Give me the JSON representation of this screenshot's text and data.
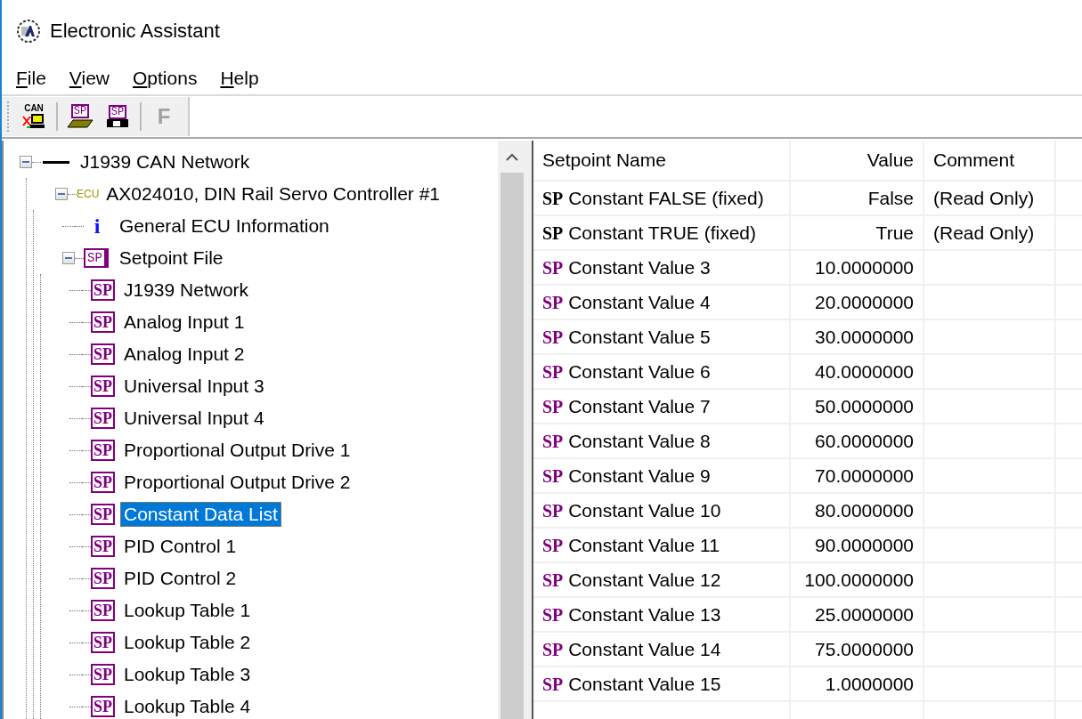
{
  "window": {
    "title": "Electronic Assistant"
  },
  "menu": [
    "File",
    "View",
    "Options",
    "Help"
  ],
  "toolbar": [
    {
      "kind": "can",
      "label": "CAN",
      "disabled": false
    },
    {
      "kind": "open",
      "label": "SP",
      "disabled": false
    },
    {
      "kind": "save",
      "label": "SP",
      "disabled": false
    },
    {
      "kind": "text",
      "label": "F",
      "disabled": true
    }
  ],
  "tree": [
    {
      "kind": "network",
      "label": "J1939 CAN Network",
      "selected": false,
      "expanded": true,
      "children": [
        {
          "kind": "ecu",
          "icon": "ECU",
          "label": "AX024010, DIN Rail Servo Controller #1",
          "selected": false,
          "expanded": true,
          "children": [
            {
              "kind": "info",
              "icon": "i",
              "label": "General ECU Information",
              "selected": false
            },
            {
              "kind": "file",
              "icon": "SP",
              "label": "Setpoint File",
              "selected": false,
              "expanded": true,
              "children": [
                {
                  "kind": "setpoint",
                  "icon": "SP",
                  "label": "J1939 Network",
                  "selected": false
                },
                {
                  "kind": "setpoint",
                  "icon": "SP",
                  "label": "Analog Input 1",
                  "selected": false
                },
                {
                  "kind": "setpoint",
                  "icon": "SP",
                  "label": "Analog Input 2",
                  "selected": false
                },
                {
                  "kind": "setpoint",
                  "icon": "SP",
                  "label": "Universal Input 3",
                  "selected": false
                },
                {
                  "kind": "setpoint",
                  "icon": "SP",
                  "label": "Universal Input 4",
                  "selected": false
                },
                {
                  "kind": "setpoint",
                  "icon": "SP",
                  "label": "Proportional Output Drive 1",
                  "selected": false
                },
                {
                  "kind": "setpoint",
                  "icon": "SP",
                  "label": "Proportional Output Drive 2",
                  "selected": false
                },
                {
                  "kind": "setpoint",
                  "icon": "SP",
                  "label": "Constant Data List",
                  "selected": true
                },
                {
                  "kind": "setpoint",
                  "icon": "SP",
                  "label": "PID Control 1",
                  "selected": false
                },
                {
                  "kind": "setpoint",
                  "icon": "SP",
                  "label": "PID Control 2",
                  "selected": false
                },
                {
                  "kind": "setpoint",
                  "icon": "SP",
                  "label": "Lookup Table 1",
                  "selected": false
                },
                {
                  "kind": "setpoint",
                  "icon": "SP",
                  "label": "Lookup Table 2",
                  "selected": false
                },
                {
                  "kind": "setpoint",
                  "icon": "SP",
                  "label": "Lookup Table 3",
                  "selected": false
                },
                {
                  "kind": "setpoint",
                  "icon": "SP",
                  "label": "Lookup Table 4",
                  "selected": false
                }
              ]
            }
          ]
        }
      ]
    }
  ],
  "table": {
    "columns": [
      "Setpoint Name",
      "Value",
      "Comment"
    ],
    "rows": [
      {
        "kind": "fixed",
        "icon": "SP",
        "name": "Constant FALSE (fixed)",
        "value": "False",
        "comment": "(Read Only)"
      },
      {
        "kind": "fixed",
        "icon": "SP",
        "name": "Constant TRUE (fixed)",
        "value": "True",
        "comment": "(Read Only)"
      },
      {
        "kind": "editable",
        "icon": "SP",
        "name": "Constant Value 3",
        "value": "10.0000000"
      },
      {
        "kind": "editable",
        "icon": "SP",
        "name": "Constant Value 4",
        "value": "20.0000000"
      },
      {
        "kind": "editable",
        "icon": "SP",
        "name": "Constant Value 5",
        "value": "30.0000000"
      },
      {
        "kind": "editable",
        "icon": "SP",
        "name": "Constant Value 6",
        "value": "40.0000000"
      },
      {
        "kind": "editable",
        "icon": "SP",
        "name": "Constant Value 7",
        "value": "50.0000000"
      },
      {
        "kind": "editable",
        "icon": "SP",
        "name": "Constant Value 8",
        "value": "60.0000000"
      },
      {
        "kind": "editable",
        "icon": "SP",
        "name": "Constant Value 9",
        "value": "70.0000000"
      },
      {
        "kind": "editable",
        "icon": "SP",
        "name": "Constant Value 10",
        "value": "80.0000000"
      },
      {
        "kind": "editable",
        "icon": "SP",
        "name": "Constant Value 11",
        "value": "90.0000000"
      },
      {
        "kind": "editable",
        "icon": "SP",
        "name": "Constant Value 12",
        "value": "100.0000000"
      },
      {
        "kind": "editable",
        "icon": "SP",
        "name": "Constant Value 13",
        "value": "25.0000000"
      },
      {
        "kind": "editable",
        "icon": "SP",
        "name": "Constant Value 14",
        "value": "75.0000000"
      },
      {
        "kind": "editable",
        "icon": "SP",
        "name": "Constant Value 15",
        "value": "1.0000000"
      }
    ]
  }
}
